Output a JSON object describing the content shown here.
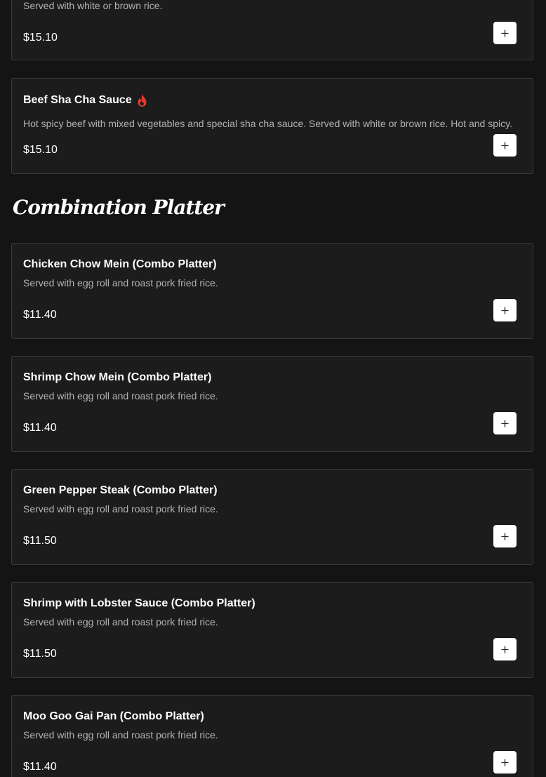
{
  "top_item": {
    "desc": "Served with white or brown rice.",
    "price": "$15.10"
  },
  "beef_item": {
    "name": "Beef Sha Cha Sauce",
    "desc": "Hot spicy beef with mixed vegetables and special sha cha sauce. Served with white or brown rice. Hot and spicy.",
    "price": "$15.10",
    "spicy_icon": "flame-icon"
  },
  "section": {
    "title": "Combination Platter"
  },
  "combo_items": [
    {
      "name": "Chicken Chow Mein (Combo Platter)",
      "desc": "Served with egg roll and roast pork fried rice.",
      "price": "$11.40"
    },
    {
      "name": "Shrimp Chow Mein (Combo Platter)",
      "desc": "Served with egg roll and roast pork fried rice.",
      "price": "$11.40"
    },
    {
      "name": "Green Pepper Steak (Combo Platter)",
      "desc": "Served with egg roll and roast pork fried rice.",
      "price": "$11.50"
    },
    {
      "name": "Shrimp with Lobster Sauce (Combo Platter)",
      "desc": "Served with egg roll and roast pork fried rice.",
      "price": "$11.50"
    },
    {
      "name": "Moo Goo Gai Pan (Combo Platter)",
      "desc": "Served with egg roll and roast pork fried rice.",
      "price": "$11.40"
    }
  ],
  "icons": {
    "add": "plus-icon",
    "spicy": "flame-icon"
  },
  "colors": {
    "background": "#141414",
    "card": "#1c1c1c",
    "card_border": "#3a3a3a",
    "add_button": "#ffffff",
    "flame": "#e23a2b"
  }
}
